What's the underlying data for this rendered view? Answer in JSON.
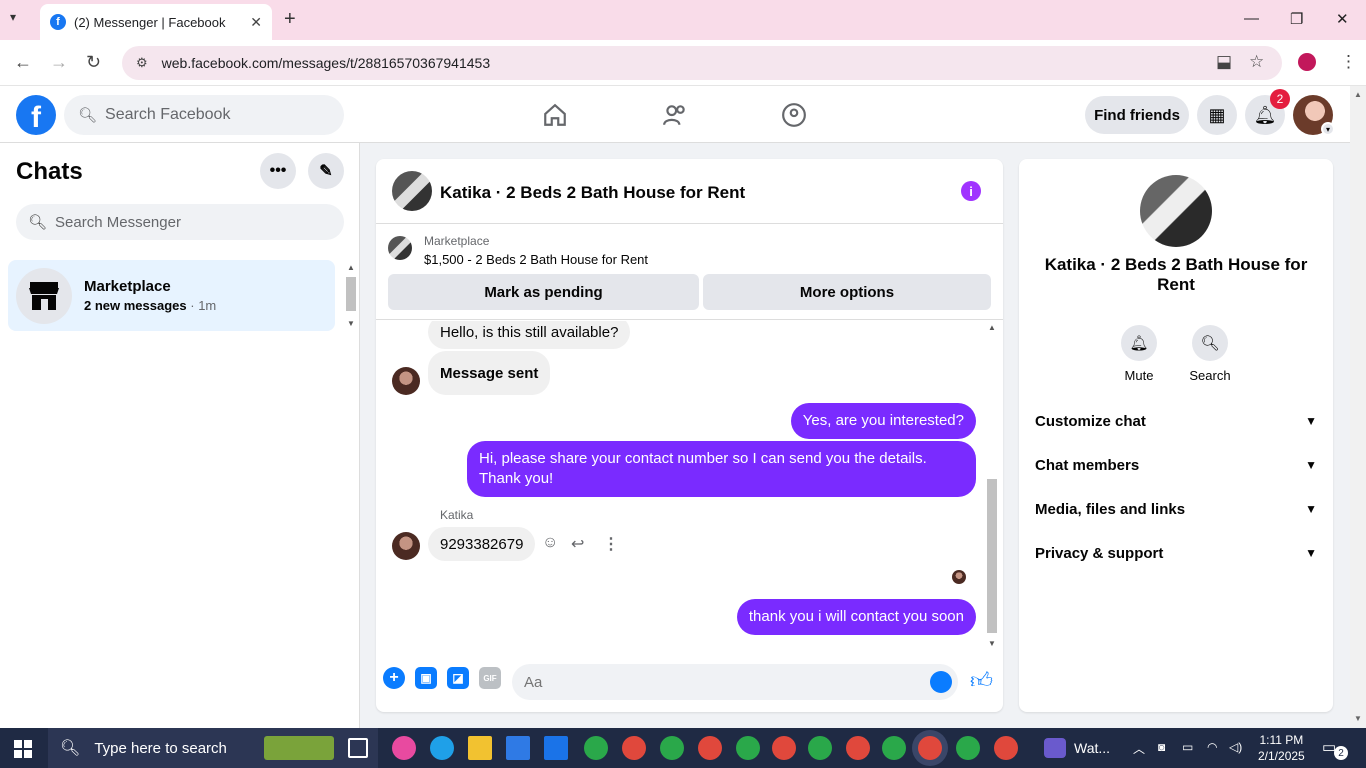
{
  "browser": {
    "tab_title": "(2) Messenger | Facebook",
    "url": "web.facebook.com/messages/t/28816570367941453"
  },
  "fb": {
    "search_placeholder": "Search Facebook",
    "find_friends": "Find friends",
    "notifications_count": "2"
  },
  "chats": {
    "title": "Chats",
    "search_placeholder": "Search Messenger",
    "items": [
      {
        "name": "Marketplace",
        "preview": "2 new messages",
        "time": "· 1m"
      }
    ]
  },
  "conversation": {
    "title": "Katika · 2 Beds 2 Bath House for Rent",
    "marketplace_label": "Marketplace",
    "listing": "$1,500 - 2 Beds 2 Bath House for Rent",
    "mark_pending": "Mark as pending",
    "more_options": "More options",
    "messages": [
      {
        "from": "them",
        "text": "Hello, is this still available?"
      },
      {
        "from": "them",
        "text": "Message sent"
      },
      {
        "from": "me",
        "text": "Yes, are you interested?"
      },
      {
        "from": "me",
        "text": "Hi, please share your contact number so I can send you the details. Thank you!"
      },
      {
        "from": "them",
        "sender": "Katika",
        "text": "9293382679"
      },
      {
        "from": "me",
        "text": "thank you i will contact you soon"
      }
    ],
    "composer_placeholder": "Aa"
  },
  "details": {
    "title": "Katika · 2 Beds 2 Bath House for Rent",
    "mute": "Mute",
    "search": "Search",
    "sections": [
      "Customize chat",
      "Chat members",
      "Media, files and links",
      "Privacy & support"
    ]
  },
  "taskbar": {
    "search_placeholder": "Type here to search",
    "app_label": "Wat...",
    "time": "1:11 PM",
    "date": "2/1/2025",
    "notif_count": "2"
  },
  "colors": {
    "fb_blue": "#1877f2",
    "outgoing_bubble": "#7a2bff",
    "selected_chat": "#e7f3ff"
  }
}
